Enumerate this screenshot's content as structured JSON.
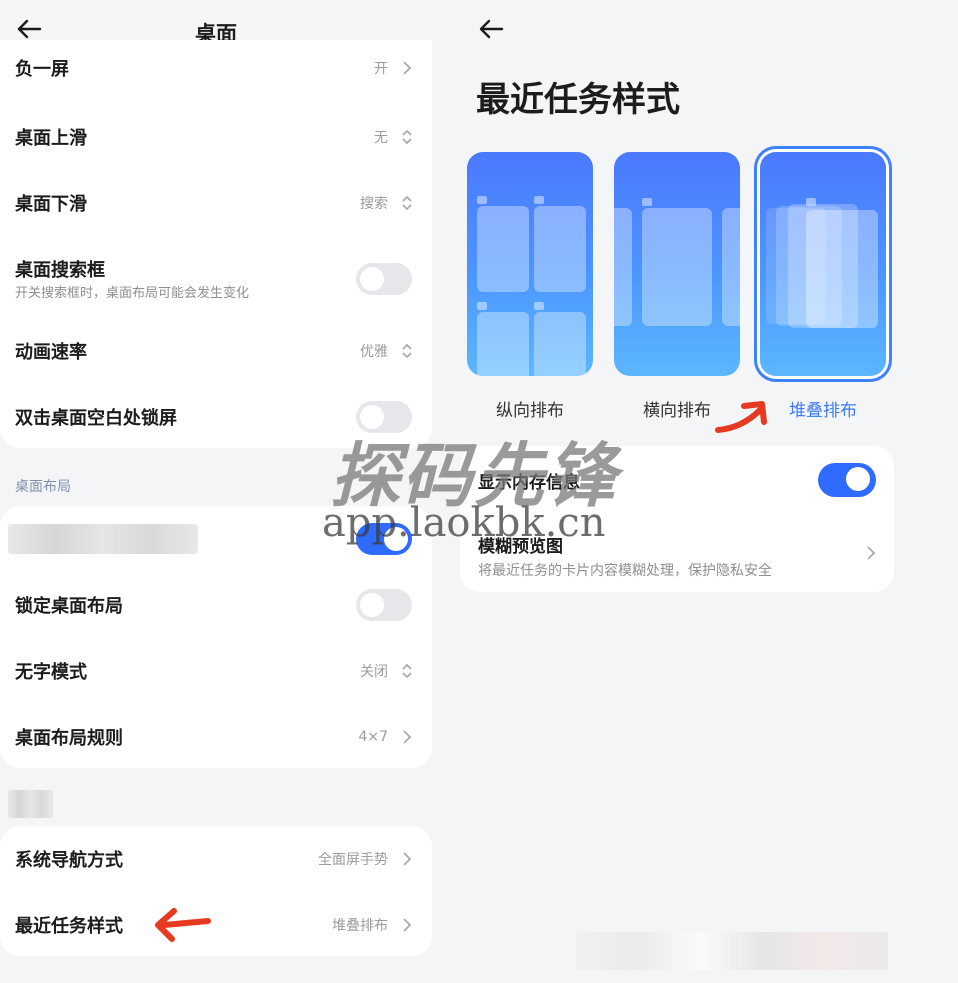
{
  "left": {
    "title": "桌面",
    "rows": [
      {
        "label": "负一屏",
        "value": "开",
        "icon": "chevron-right-icon"
      },
      {
        "label": "桌面上滑",
        "value": "无",
        "icon": "updown-chevron-icon"
      },
      {
        "label": "桌面下滑",
        "value": "搜索",
        "icon": "updown-chevron-icon"
      },
      {
        "label": "桌面搜索框",
        "sub": "开关搜索框时，桌面布局可能会发生变化",
        "toggle": false
      },
      {
        "label": "动画速率",
        "value": "优雅",
        "icon": "updown-chevron-icon"
      },
      {
        "label": "双击桌面空白处锁屏",
        "toggle": false
      }
    ],
    "layout_section": {
      "title": "桌面布局",
      "rows": [
        {
          "label": "",
          "toggle": true
        },
        {
          "label": "锁定桌面布局",
          "toggle": false
        },
        {
          "label": "无字模式",
          "value": "关闭",
          "icon": "updown-chevron-icon"
        },
        {
          "label": "桌面布局规则",
          "value": "4×7",
          "icon": "chevron-right-icon"
        }
      ]
    },
    "system_section": {
      "rows": [
        {
          "label": "系统导航方式",
          "value": "全面屏手势",
          "icon": "chevron-right-icon"
        },
        {
          "label": "最近任务样式",
          "value": "堆叠排布",
          "icon": "chevron-right-icon"
        }
      ]
    }
  },
  "right": {
    "title": "最近任务样式",
    "styles": [
      {
        "label": "纵向排布",
        "selected": false
      },
      {
        "label": "横向排布",
        "selected": false
      },
      {
        "label": "堆叠排布",
        "selected": true
      }
    ],
    "options": [
      {
        "label": "显示内存信息",
        "toggle": true
      },
      {
        "label": "模糊预览图",
        "sub": "将最近任务的卡片内容模糊处理，保护隐私安全",
        "icon": "chevron-right-icon"
      }
    ]
  },
  "watermark": {
    "text": "探码先锋",
    "url": "app.laokbk.cn"
  },
  "colors": {
    "accent": "#2f6bff",
    "arrow": "#e53a1f",
    "background": "#f4f5f7"
  }
}
